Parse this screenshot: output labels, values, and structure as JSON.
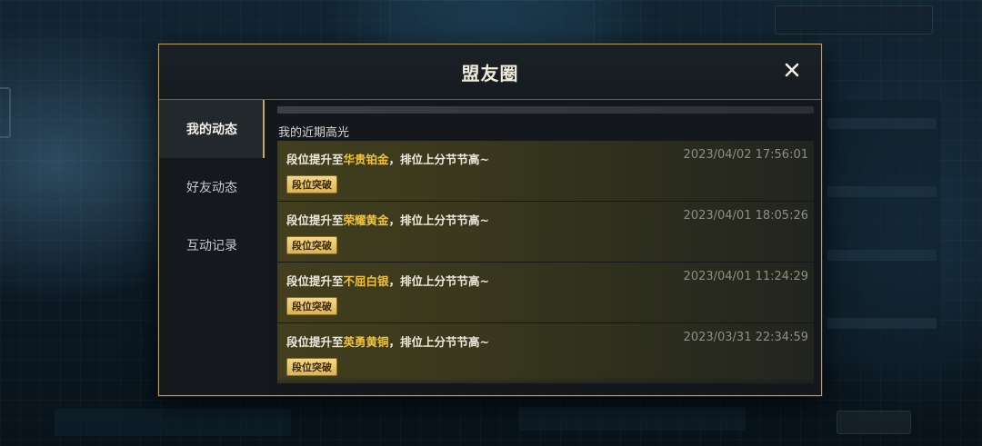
{
  "dialog": {
    "title": "盟友圈",
    "close_icon": "close-icon"
  },
  "sidebar": {
    "items": [
      {
        "label": "我的动态",
        "active": true
      },
      {
        "label": "好友动态",
        "active": false
      },
      {
        "label": "互动记录",
        "active": false
      }
    ]
  },
  "section": {
    "title": "我的近期高光"
  },
  "feed": [
    {
      "prefix": "段位提升至",
      "rank": "华贵铂金",
      "suffix": "，排位上分节节高~",
      "time": "2023/04/02 17:56:01",
      "badge": "段位突破"
    },
    {
      "prefix": "段位提升至",
      "rank": "荣耀黄金",
      "suffix": "，排位上分节节高~",
      "time": "2023/04/01 18:05:26",
      "badge": "段位突破"
    },
    {
      "prefix": "段位提升至",
      "rank": "不屈白银",
      "suffix": "，排位上分节节高~",
      "time": "2023/04/01 11:24:29",
      "badge": "段位突破"
    },
    {
      "prefix": "段位提升至",
      "rank": "英勇黄铜",
      "suffix": "，排位上分节节高~",
      "time": "2023/03/31 22:34:59",
      "badge": "段位突破"
    }
  ],
  "colors": {
    "accent_gold": "#c8a95c",
    "rank_highlight": "#f1c232",
    "border": "#b49c62"
  }
}
